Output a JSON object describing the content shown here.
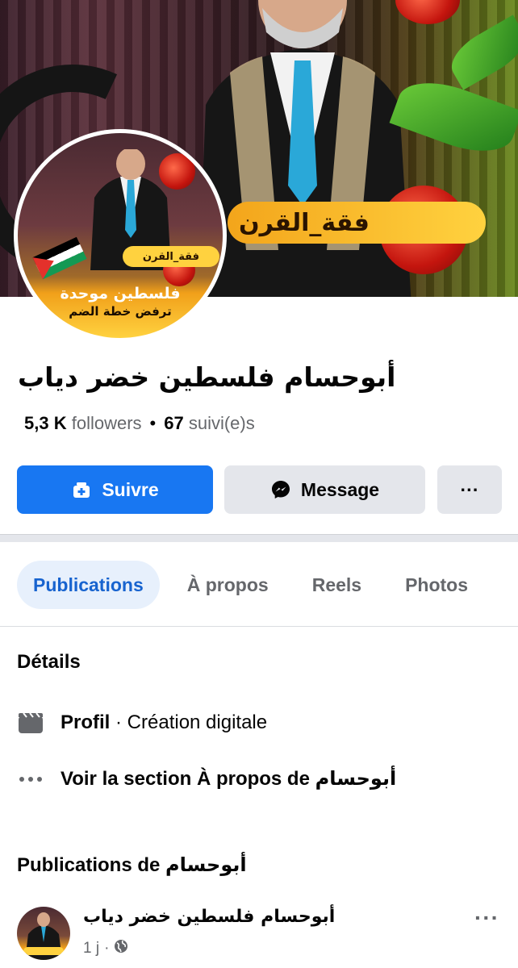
{
  "cover": {
    "banner_text": "فقة_القرن"
  },
  "avatar": {
    "banner_text": "فقة_القرن",
    "line1": "فلسطين موحدة",
    "line2": "ترفض خطة الضم"
  },
  "profile": {
    "name": "أبوحسام فلسطين خضر دياب",
    "followers_count": "5,3 K",
    "followers_label": "followers",
    "following_count": "67",
    "following_label": "suivi(e)s"
  },
  "actions": {
    "follow_label": "Suivre",
    "message_label": "Message",
    "more_label": "···"
  },
  "tabs": [
    {
      "label": "Publications",
      "active": true
    },
    {
      "label": "À propos",
      "active": false
    },
    {
      "label": "Reels",
      "active": false
    },
    {
      "label": "Photos",
      "active": false
    }
  ],
  "details": {
    "title": "Détails",
    "profile_bold": "Profil",
    "profile_rest": " · Création digitale",
    "about_prefix": "Voir la section À propos de ",
    "about_name": "أبوحسام"
  },
  "posts_section": {
    "title_prefix": "Publications de ",
    "title_name": "أبوحسام"
  },
  "post": {
    "author": "أبوحسام فلسطين خضر دياب",
    "time": "1 j",
    "more_label": "···"
  },
  "colors": {
    "primary": "#1877f2",
    "tab_active_bg": "#e7f0fc",
    "tab_active_text": "#1763cf",
    "secondary_button": "#e4e6eb",
    "muted_text": "#65676b"
  }
}
